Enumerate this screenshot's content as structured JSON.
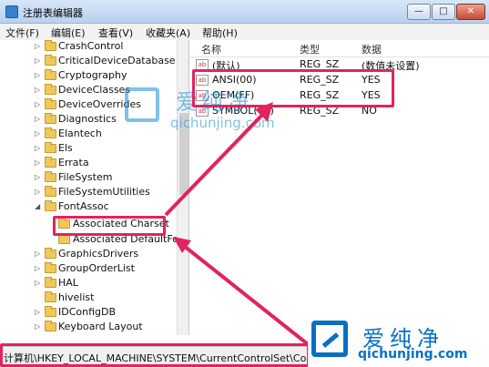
{
  "window": {
    "title": "注册表编辑器",
    "buttons": {
      "minimize": "—",
      "maximize": "□",
      "close": "✕"
    }
  },
  "menu": [
    "文件(F)",
    "编辑(E)",
    "查看(V)",
    "收藏夹(A)",
    "帮助(H)"
  ],
  "tree": [
    "CrashControl",
    "CriticalDeviceDatabase",
    "Cryptography",
    "DeviceClasses",
    "DeviceOverrides",
    "Diagnostics",
    "Elantech",
    "Els",
    "Errata",
    "FileSystem",
    "FileSystemUtilities",
    "FontAssoc",
    "Associated Charset",
    "Associated DefaultFo",
    "GraphicsDrivers",
    "GroupOrderList",
    "HAL",
    "hivelist",
    "IDConfigDB",
    "Keyboard Layout"
  ],
  "columns": {
    "name": "名称",
    "type": "类型",
    "data": "数据"
  },
  "values": [
    {
      "name": "(默认)",
      "type": "REG_SZ",
      "data": "(数值未设置)"
    },
    {
      "name": "ANSI(00)",
      "type": "REG_SZ",
      "data": "YES"
    },
    {
      "name": "OEM(FF)",
      "type": "REG_SZ",
      "data": "YES"
    },
    {
      "name": "SYMBOL(02)",
      "type": "REG_SZ",
      "data": "NO"
    }
  ],
  "status": "计算机\\HKEY_LOCAL_MACHINE\\SYSTEM\\CurrentControlSet\\Contr",
  "watermark": {
    "text": "爱纯净",
    "url": "qichunjing.com"
  },
  "colors": {
    "highlight": "#e0245e",
    "watermark": "#0a6fc4"
  }
}
